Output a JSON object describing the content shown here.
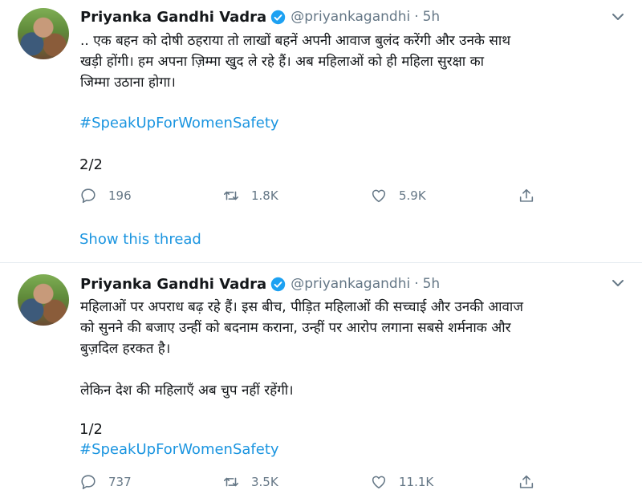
{
  "tweets": [
    {
      "author_name": "Priyanka Gandhi Vadra",
      "handle": "@priyankagandhi",
      "separator": "·",
      "time": "5h",
      "lines": [
        ".. एक बहन को दोषी ठहराया तो लाखों बहनें अपनी आवाज बुलंद करेंगी और उनके साथ",
        "खड़ी होंगी। हम अपना ज़िम्मा खुद ले रहे हैं। अब महिलाओं को ही महिला सुरक्षा का",
        "जिम्मा उठाना होगा।"
      ],
      "hashtag": "#SpeakUpForWomenSafety",
      "thread_counter": "2/2",
      "replies": "196",
      "retweets": "1.8K",
      "likes": "5.9K",
      "show_thread": "Show this thread"
    },
    {
      "author_name": "Priyanka Gandhi Vadra",
      "handle": "@priyankagandhi",
      "separator": "·",
      "time": "5h",
      "lines": [
        "महिलाओं पर अपराध बढ़ रहे हैं। इस बीच, पीड़ित महिलाओं की सच्चाई और उनकी आवाज",
        "को सुनने की बजाए उन्हीं को बदनाम कराना, उन्हीं पर आरोप लगाना सबसे शर्मनाक और",
        "बुज़दिल हरकत है।",
        "लेकिन देश की महिलाएँ अब चुप नहीं रहेंगी।"
      ],
      "thread_counter": "1/2",
      "hashtag": "#SpeakUpForWomenSafety",
      "replies": "737",
      "retweets": "3.5K",
      "likes": "11.1K"
    }
  ],
  "colors": {
    "link": "#1b95e0",
    "secondary": "#657786",
    "verified": "#1da1f2",
    "divider": "#e6ecf0"
  },
  "icons": [
    "verified-badge-icon",
    "chevron-down-icon",
    "reply-icon",
    "retweet-icon",
    "like-icon",
    "share-icon"
  ]
}
